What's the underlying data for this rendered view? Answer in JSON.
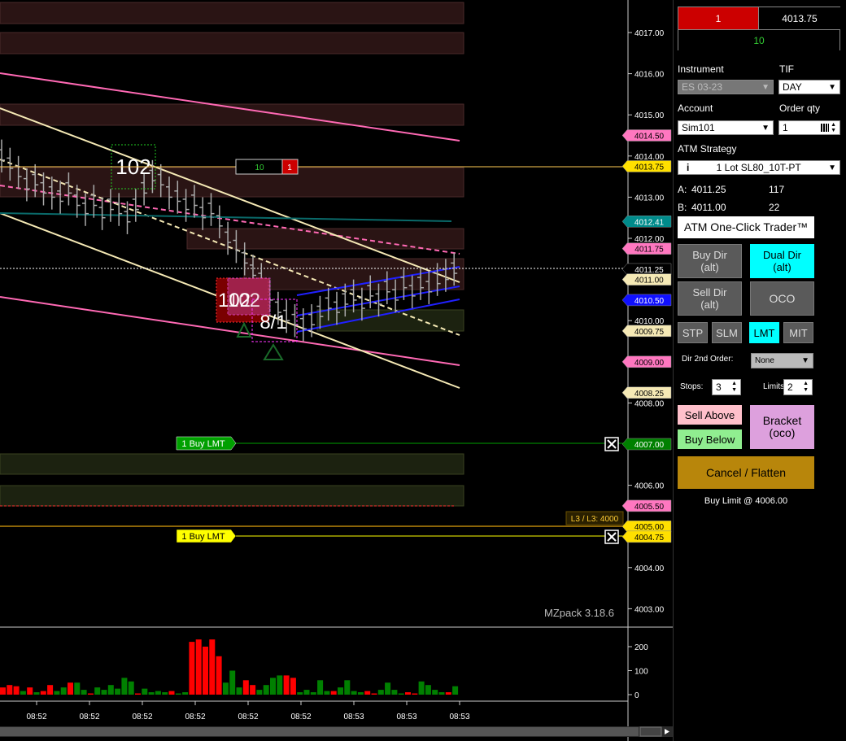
{
  "price_axis": {
    "ticks": [
      "4017.00",
      "4016.00",
      "4015.00",
      "4014.00",
      "4013.00",
      "4012.00",
      "4011.00",
      "4010.00",
      "4009.00",
      "4008.00",
      "4007.00",
      "4006.00",
      "4005.00",
      "4004.00",
      "4003.00"
    ],
    "tags": [
      {
        "text": "4014.50",
        "bg": "#ff77c0",
        "fg": "#000"
      },
      {
        "text": "4013.75",
        "bg": "#ffe000",
        "fg": "#000"
      },
      {
        "text": "4012.41",
        "bg": "#008b8b",
        "fg": "#fff"
      },
      {
        "text": "4011.75",
        "bg": "#ff77c0",
        "fg": "#000"
      },
      {
        "text": "4011.25",
        "bg": "#000",
        "fg": "#fff"
      },
      {
        "text": "4011.00",
        "bg": "#f5e9b5",
        "fg": "#000"
      },
      {
        "text": "4010.50",
        "bg": "#1010ff",
        "fg": "#fff"
      },
      {
        "text": "4009.75",
        "bg": "#f5e9b5",
        "fg": "#000"
      },
      {
        "text": "4009.00",
        "bg": "#ff77c0",
        "fg": "#000"
      },
      {
        "text": "4008.25",
        "bg": "#f5e9b5",
        "fg": "#000"
      },
      {
        "text": "4007.00",
        "bg": "#008000",
        "fg": "#fff"
      },
      {
        "text": "4005.50",
        "bg": "#ff77c0",
        "fg": "#000"
      },
      {
        "text": "4005.00",
        "bg": "#ffe000",
        "fg": "#000"
      },
      {
        "text": "4004.75",
        "bg": "#ffe000",
        "fg": "#000"
      }
    ]
  },
  "volume_axis": {
    "ticks": [
      "200",
      "100",
      "0"
    ]
  },
  "time_axis": {
    "ticks": [
      "08:52",
      "08:52",
      "08:52",
      "08:52",
      "08:52",
      "08:52",
      "08:53",
      "08:53",
      "08:53"
    ]
  },
  "chart": {
    "position_box": {
      "qty": "10",
      "pos": "1"
    },
    "orders": [
      {
        "label": "1  Buy LMT",
        "color": "#00a000"
      },
      {
        "label": "1  Buy LMT",
        "color": "#ffff00"
      }
    ],
    "level_label": "L3 / L3: 4000",
    "watermark": "MZpack 3.18.6",
    "annotations": [
      "102",
      "102",
      "102",
      "8/1"
    ]
  },
  "panel": {
    "top": {
      "position_qty": "1",
      "avg_price": "4013.75",
      "pnl": "10"
    },
    "instrument_label": "Instrument",
    "instrument_value": "ES 03-23",
    "tif_label": "TIF",
    "tif_value": "DAY",
    "account_label": "Account",
    "account_value": "Sim101",
    "order_qty_label": "Order qty",
    "order_qty_value": "1",
    "atm_label": "ATM Strategy",
    "atm_value": "1 Lot  SL80_10T-PT",
    "ask_label": "A:",
    "ask_price": "4011.25",
    "ask_size": "117",
    "bid_label": "B:",
    "bid_price": "4011.00",
    "bid_size": "22",
    "one_click": "ATM One-Click Trader™",
    "buy_dir": "Buy Dir\n(alt)",
    "dual_dir": "Dual Dir\n(alt)",
    "sell_dir": "Sell Dir\n(alt)",
    "oco": "OCO",
    "stp": "STP",
    "slm": "SLM",
    "lmt": "LMT",
    "mit": "MIT",
    "dir2_label": "Dir 2nd Order:",
    "dir2_value": "None",
    "stops_label": "Stops:",
    "stops_value": "3",
    "limits_label": "Limits:",
    "limits_value": "2",
    "sell_above": "Sell Above",
    "buy_below": "Buy Below",
    "bracket": "Bracket\n(oco)",
    "cancel_flatten": "Cancel / Flatten",
    "status": "Buy Limit @ 4006.00"
  },
  "colors": {
    "accent_red": "#cc0000",
    "cyan": "#00ffff",
    "pink": "#ff77c0",
    "gold": "#b8860b",
    "sell_above_bg": "#ffc0cb",
    "buy_below_bg": "#90ee90",
    "bracket_bg": "#dda0dd"
  },
  "volume_bars": [
    {
      "v": 30,
      "c": "r"
    },
    {
      "v": 40,
      "c": "r"
    },
    {
      "v": 35,
      "c": "r"
    },
    {
      "v": 15,
      "c": "g"
    },
    {
      "v": 30,
      "c": "r"
    },
    {
      "v": 10,
      "c": "g"
    },
    {
      "v": 15,
      "c": "r"
    },
    {
      "v": 40,
      "c": "r"
    },
    {
      "v": 15,
      "c": "g"
    },
    {
      "v": 30,
      "c": "g"
    },
    {
      "v": 50,
      "c": "r"
    },
    {
      "v": 50,
      "c": "g"
    },
    {
      "v": 20,
      "c": "g"
    },
    {
      "v": 5,
      "c": "r"
    },
    {
      "v": 30,
      "c": "g"
    },
    {
      "v": 20,
      "c": "g"
    },
    {
      "v": 40,
      "c": "g"
    },
    {
      "v": 25,
      "c": "g"
    },
    {
      "v": 70,
      "c": "g"
    },
    {
      "v": 55,
      "c": "g"
    },
    {
      "v": 5,
      "c": "r"
    },
    {
      "v": 25,
      "c": "g"
    },
    {
      "v": 10,
      "c": "g"
    },
    {
      "v": 15,
      "c": "g"
    },
    {
      "v": 10,
      "c": "g"
    },
    {
      "v": 15,
      "c": "r"
    },
    {
      "v": 5,
      "c": "g"
    },
    {
      "v": 10,
      "c": "g"
    },
    {
      "v": 220,
      "c": "r"
    },
    {
      "v": 230,
      "c": "r"
    },
    {
      "v": 200,
      "c": "r"
    },
    {
      "v": 230,
      "c": "r"
    },
    {
      "v": 160,
      "c": "r"
    },
    {
      "v": 50,
      "c": "g"
    },
    {
      "v": 100,
      "c": "g"
    },
    {
      "v": 30,
      "c": "g"
    },
    {
      "v": 60,
      "c": "r"
    },
    {
      "v": 40,
      "c": "r"
    },
    {
      "v": 20,
      "c": "g"
    },
    {
      "v": 40,
      "c": "g"
    },
    {
      "v": 70,
      "c": "g"
    },
    {
      "v": 80,
      "c": "g"
    },
    {
      "v": 80,
      "c": "r"
    },
    {
      "v": 70,
      "c": "r"
    },
    {
      "v": 10,
      "c": "g"
    },
    {
      "v": 20,
      "c": "g"
    },
    {
      "v": 10,
      "c": "g"
    },
    {
      "v": 60,
      "c": "g"
    },
    {
      "v": 15,
      "c": "g"
    },
    {
      "v": 15,
      "c": "r"
    },
    {
      "v": 30,
      "c": "g"
    },
    {
      "v": 60,
      "c": "g"
    },
    {
      "v": 15,
      "c": "g"
    },
    {
      "v": 10,
      "c": "g"
    },
    {
      "v": 15,
      "c": "r"
    },
    {
      "v": 5,
      "c": "r"
    },
    {
      "v": 20,
      "c": "g"
    },
    {
      "v": 50,
      "c": "g"
    },
    {
      "v": 20,
      "c": "g"
    },
    {
      "v": 5,
      "c": "g"
    },
    {
      "v": 10,
      "c": "r"
    },
    {
      "v": 5,
      "c": "r"
    },
    {
      "v": 55,
      "c": "g"
    },
    {
      "v": 40,
      "c": "g"
    },
    {
      "v": 20,
      "c": "g"
    },
    {
      "v": 10,
      "c": "g"
    },
    {
      "v": 10,
      "c": "r"
    },
    {
      "v": 35,
      "c": "g"
    }
  ]
}
